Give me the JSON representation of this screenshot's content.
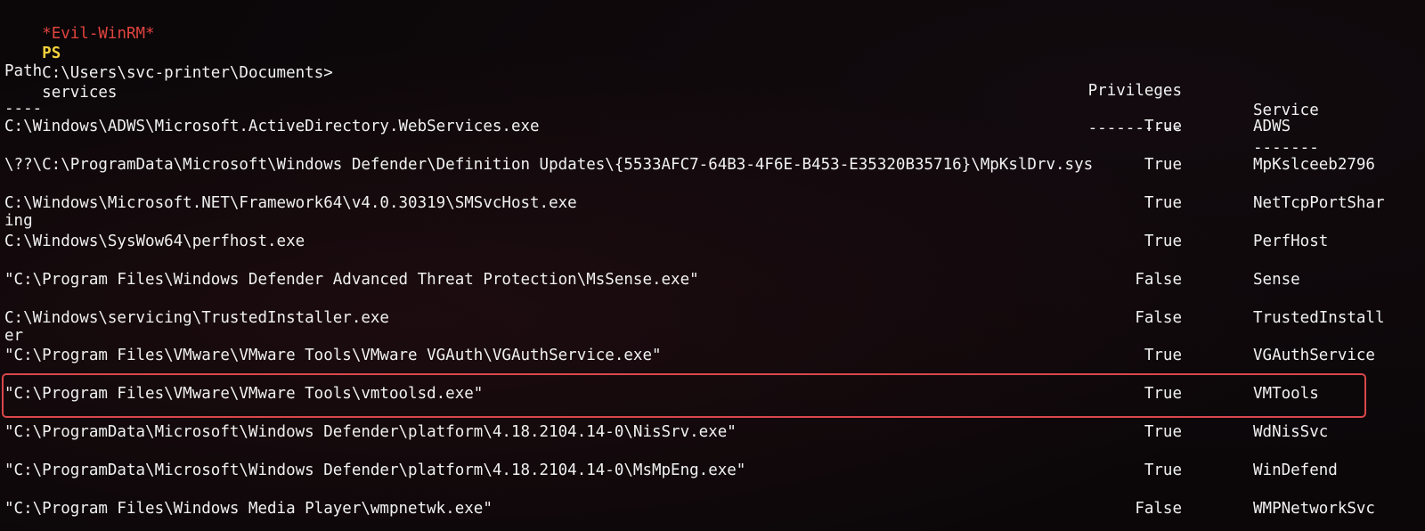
{
  "prompt": {
    "evil": "*Evil-WinRM*",
    "ps": "PS",
    "path": "C:\\Users\\svc-printer\\Documents>",
    "command": "services"
  },
  "headers": {
    "path": "Path",
    "privileges": "Privileges",
    "service": "Service"
  },
  "separators": {
    "path": "----",
    "privileges": "----------",
    "service": "-------"
  },
  "rows": [
    {
      "path": "C:\\Windows\\ADWS\\Microsoft.ActiveDirectory.WebServices.exe",
      "privileges": "True",
      "service": "ADWS",
      "wrap": ""
    },
    {
      "path": "\\??\\C:\\ProgramData\\Microsoft\\Windows Defender\\Definition Updates\\{5533AFC7-64B3-4F6E-B453-E35320B35716}\\MpKslDrv.sys",
      "privileges": "True",
      "service": "MpKslceeb2796",
      "wrap": ""
    },
    {
      "path": "C:\\Windows\\Microsoft.NET\\Framework64\\v4.0.30319\\SMSvcHost.exe",
      "privileges": "True",
      "service": "NetTcpPortShar",
      "wrap": "ing"
    },
    {
      "path": "C:\\Windows\\SysWow64\\perfhost.exe",
      "privileges": "True",
      "service": "PerfHost",
      "wrap": ""
    },
    {
      "path": "\"C:\\Program Files\\Windows Defender Advanced Threat Protection\\MsSense.exe\"",
      "privileges": "False",
      "service": "Sense",
      "wrap": ""
    },
    {
      "path": "C:\\Windows\\servicing\\TrustedInstaller.exe",
      "privileges": "False",
      "service": "TrustedInstall",
      "wrap": "er"
    },
    {
      "path": "\"C:\\Program Files\\VMware\\VMware Tools\\VMware VGAuth\\VGAuthService.exe\"",
      "privileges": "True",
      "service": "VGAuthService",
      "wrap": ""
    },
    {
      "path": "\"C:\\Program Files\\VMware\\VMware Tools\\vmtoolsd.exe\"",
      "privileges": "True",
      "service": "VMTools",
      "wrap": ""
    },
    {
      "path": "\"C:\\ProgramData\\Microsoft\\Windows Defender\\platform\\4.18.2104.14-0\\NisSrv.exe\"",
      "privileges": "True",
      "service": "WdNisSvc",
      "wrap": ""
    },
    {
      "path": "\"C:\\ProgramData\\Microsoft\\Windows Defender\\platform\\4.18.2104.14-0\\MsMpEng.exe\"",
      "privileges": "True",
      "service": "WinDefend",
      "wrap": ""
    },
    {
      "path": "\"C:\\Program Files\\Windows Media Player\\wmpnetwk.exe\"",
      "privileges": "False",
      "service": "WMPNetworkSvc",
      "wrap": ""
    }
  ],
  "highlighted_row": 7
}
